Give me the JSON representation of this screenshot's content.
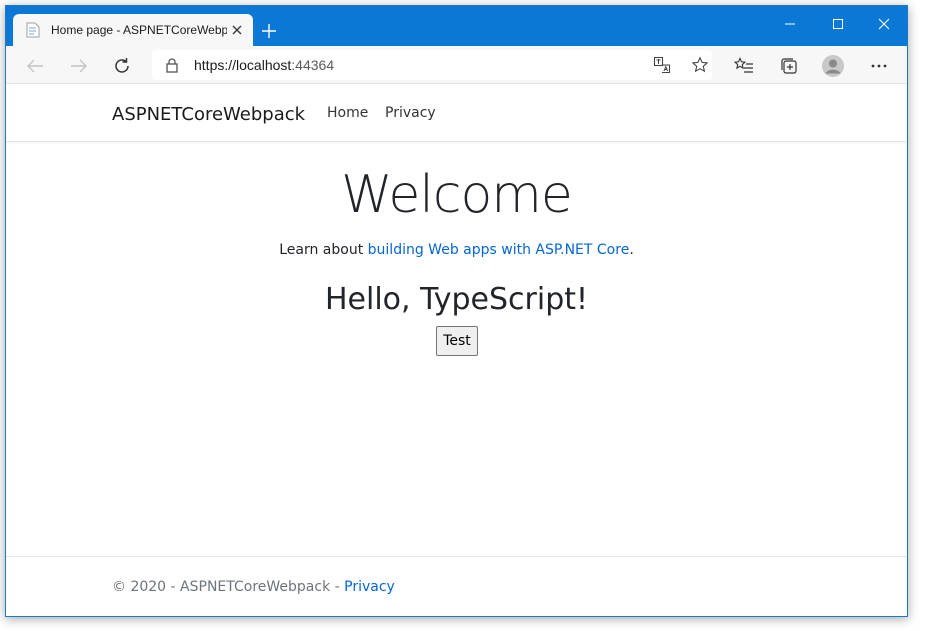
{
  "browser": {
    "tab": {
      "title": "Home page - ASPNETCoreWebpack"
    },
    "address": {
      "scheme": "https://",
      "host": "localhost",
      "port": ":44364"
    }
  },
  "nav": {
    "brand": "ASPNETCoreWebpack",
    "links": [
      "Home",
      "Privacy"
    ]
  },
  "main": {
    "welcome": "Welcome",
    "learn_prefix": "Learn about ",
    "learn_link": "building Web apps with ASP.NET Core",
    "learn_suffix": ".",
    "hello": "Hello, TypeScript!",
    "test_button": "Test"
  },
  "footer": {
    "copyright": "© 2020 - ASPNETCoreWebpack - ",
    "privacy_link": "Privacy"
  },
  "colors": {
    "titlebar": "#0a78d4",
    "link": "#0366d6"
  }
}
